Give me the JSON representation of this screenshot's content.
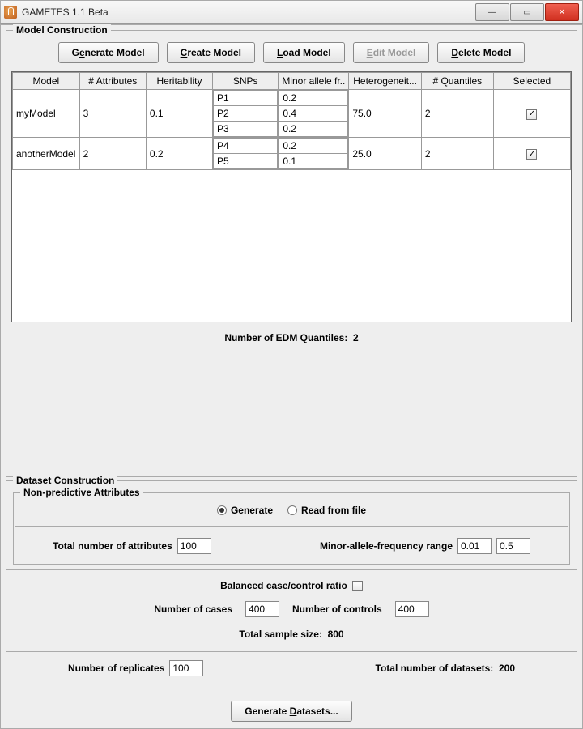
{
  "window": {
    "title": "GAMETES 1.1 Beta"
  },
  "model_construction": {
    "title": "Model Construction",
    "buttons": {
      "generate_pre": "G",
      "generate_u": "e",
      "generate_post": "nerate Model",
      "create_pre": "",
      "create_u": "C",
      "create_post": "reate Model",
      "load_pre": "",
      "load_u": "L",
      "load_post": "oad Model",
      "edit_pre": "",
      "edit_u": "E",
      "edit_post": "dit Model",
      "delete_pre": "",
      "delete_u": "D",
      "delete_post": "elete Model"
    },
    "headers": {
      "model": "Model",
      "attributes": "# Attributes",
      "heritability": "Heritability",
      "snps": "SNPs",
      "maf": "Minor allele fr..",
      "hetero": "Heterogeneit...",
      "quantiles": "# Quantiles",
      "selected": "Selected"
    },
    "rows": [
      {
        "model": "myModel",
        "attributes": "3",
        "heritability": "0.1",
        "snps": [
          "P1",
          "P2",
          "P3"
        ],
        "mafs": [
          "0.2",
          "0.4",
          "0.2"
        ],
        "hetero": "75.0",
        "quantiles": "2",
        "selected": true
      },
      {
        "model": "anotherModel",
        "attributes": "2",
        "heritability": "0.2",
        "snps": [
          "P4",
          "P5"
        ],
        "mafs": [
          "0.2",
          "0.1"
        ],
        "hetero": "25.0",
        "quantiles": "2",
        "selected": true
      }
    ],
    "edm_label": "Number of EDM Quantiles:",
    "edm_value": "2"
  },
  "dataset_construction": {
    "title": "Dataset Construction",
    "nonpredictive": {
      "title": "Non-predictive Attributes",
      "radio_generate": "Generate",
      "radio_readfile": "Read from file",
      "total_attr_label": "Total number of attributes",
      "total_attr_value": "100",
      "maf_range_label": "Minor-allele-frequency range",
      "maf_range_lo": "0.01",
      "maf_range_hi": "0.5"
    },
    "balanced_label": "Balanced case/control ratio",
    "cases_label": "Number of cases",
    "cases_value": "400",
    "controls_label": "Number of controls",
    "controls_value": "400",
    "total_sample_label": "Total sample size:",
    "total_sample_value": "800",
    "replicates_label": "Number of replicates",
    "replicates_value": "100",
    "total_datasets_label": "Total number of datasets:",
    "total_datasets_value": "200",
    "generate_btn_pre": "Generate ",
    "generate_btn_u": "D",
    "generate_btn_post": "atasets..."
  }
}
